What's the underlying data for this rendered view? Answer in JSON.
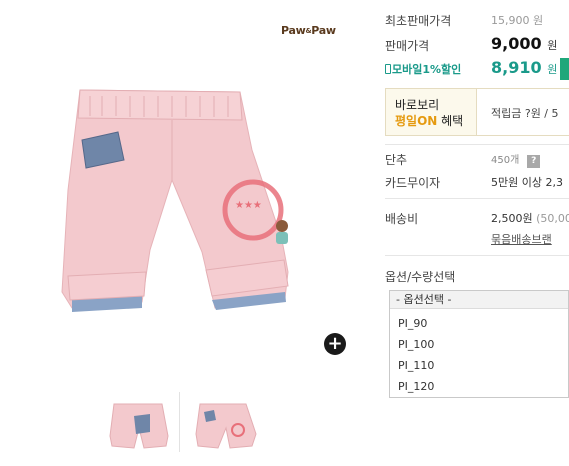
{
  "brand": {
    "logo_text": "Paw",
    "logo_amp": "&",
    "logo_text2": "Paw"
  },
  "price": {
    "original_label": "최초판매가격",
    "original_value": "15,900 원",
    "sale_label": "판매가격",
    "sale_value": "9,000",
    "sale_unit": "원",
    "mobile_label": "모바일1%할인",
    "mobile_value": "8,910",
    "mobile_unit": "원"
  },
  "promo": {
    "line1": "바로보리",
    "line2_highlight": "평일ON",
    "line2_rest": " 혜택",
    "points_text": "적립금 ?원 / 5"
  },
  "details": {
    "stock_label": "단추",
    "stock_value": "450개",
    "stock_help": "?",
    "card_label": "카드무이자",
    "card_value": "5만원 이상 2,3",
    "ship_label": "배송비",
    "ship_value": "2,500원",
    "ship_note": " (50,00",
    "bundle_link": "묶음배송브랜"
  },
  "options": {
    "label": "옵션/수량선택",
    "placeholder": "- 옵션선택 -",
    "items": [
      "PI_90",
      "PI_100",
      "PI_110",
      "PI_120"
    ]
  },
  "colors": {
    "accent_teal": "#1a9a8a",
    "promo_orange": "#e59a10",
    "product_pink": "#f2c6ca",
    "pocket_blue": "#6f86a8"
  },
  "icons": {
    "zoom": "plus-circle-icon",
    "help": "question-square-icon"
  }
}
